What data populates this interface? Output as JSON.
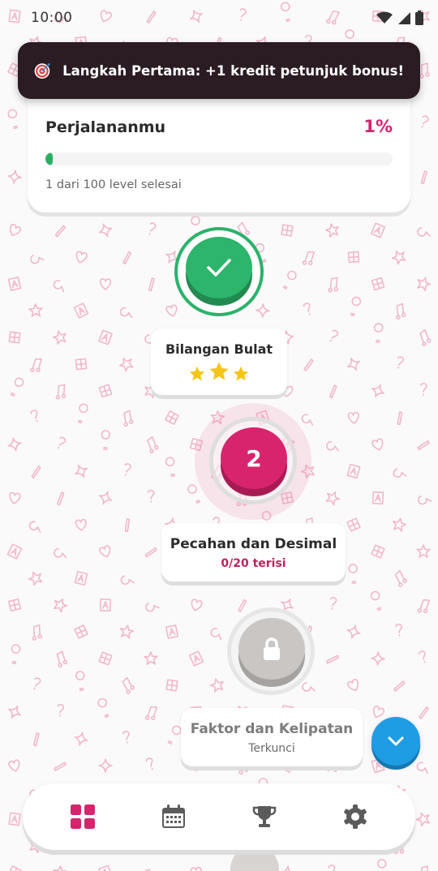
{
  "status_bar": {
    "time": "10:00",
    "icons": [
      "wifi-icon",
      "signal-icon",
      "battery-icon"
    ]
  },
  "toast": {
    "icon": "target-icon",
    "text": "Langkah Pertama: +1 kredit petunjuk bonus!"
  },
  "progress": {
    "title": "Perjalananmu",
    "percent_label": "1%",
    "fraction": 0.01,
    "subtitle": "1 dari 100 level selesai"
  },
  "levels": [
    {
      "state": "completed",
      "icon": "checkmark-icon",
      "title": "Bilangan Bulat",
      "stars": 3
    },
    {
      "state": "current",
      "number": "2",
      "title": "Pecahan dan Desimal",
      "subtitle": "0/20 terisi"
    },
    {
      "state": "locked",
      "icon": "lock-icon",
      "title": "Faktor dan Kelipatan",
      "subtitle": "Terkunci"
    }
  ],
  "fab": {
    "icon": "chevron-down-icon"
  },
  "bottom_nav": [
    {
      "icon": "grid-icon",
      "active": true
    },
    {
      "icon": "calendar-icon",
      "active": false
    },
    {
      "icon": "trophy-icon",
      "active": false
    },
    {
      "icon": "gear-icon",
      "active": false
    }
  ],
  "colors": {
    "accent_pink": "#d8246c",
    "success_green": "#2cb56b",
    "locked_gray": "#c9c6c3",
    "fab_blue": "#1e9de4",
    "pattern_pink": "#f3b6cc",
    "star_gold": "#f5c518",
    "toast_bg": "#2a1c22"
  }
}
